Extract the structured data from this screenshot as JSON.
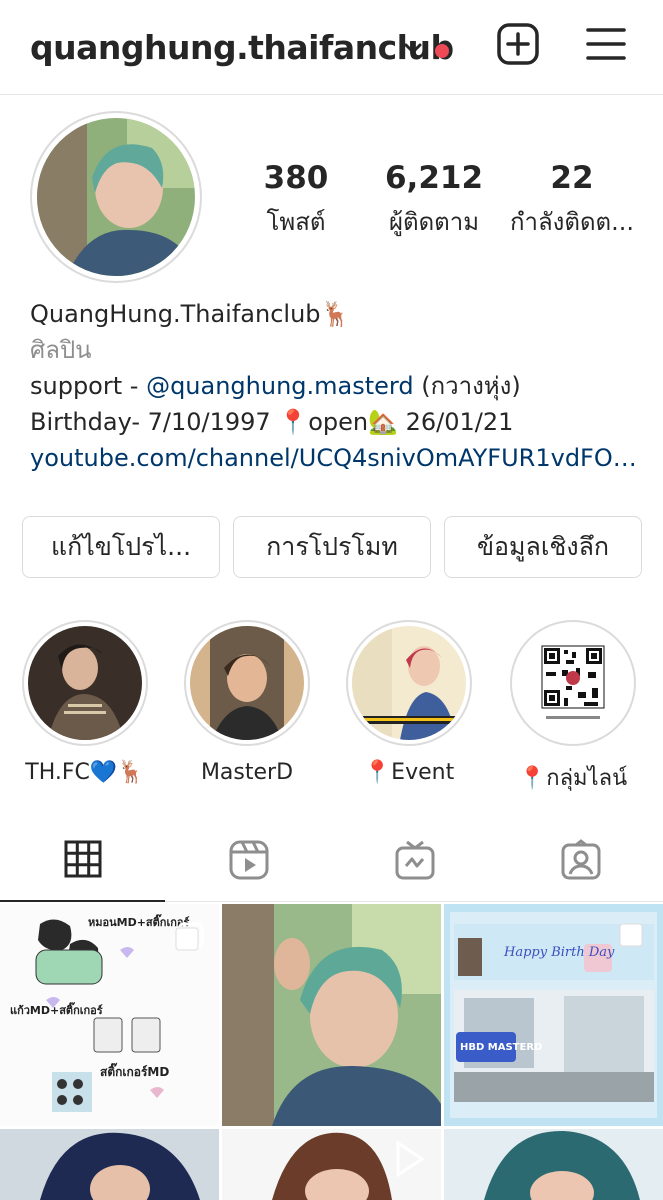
{
  "header": {
    "username": "quanghung.thaifanclub",
    "icons": [
      "chevron-down-icon",
      "notification-dot",
      "add-post-icon",
      "menu-icon"
    ],
    "notification_color": "#ed4956"
  },
  "profile": {
    "stats": [
      {
        "value": "380",
        "label": "โพสต์"
      },
      {
        "value": "6,212",
        "label": "ผู้ติดตาม"
      },
      {
        "value": "22",
        "label": "กำลังติดต..."
      }
    ],
    "display_name": "QuangHung.Thaifanclub🦌",
    "category": "ศิลปิน",
    "bio_line1_prefix": "support - ",
    "bio_line1_mention": "@quanghung.masterd",
    "bio_line1_suffix": " (กวางหุ่ง)",
    "bio_line2": "Birthday- 7/10/1997 📍open🏡 26/01/21",
    "link": "youtube.com/channel/UCQ4snivOmAYFUR1vdFOw..."
  },
  "actions": {
    "edit_profile": "แก้ไขโปรไ...",
    "promote": "การโปรโมท",
    "insights": "ข้อมูลเชิงลึก"
  },
  "highlights": [
    {
      "label": "TH.FC💙🦌"
    },
    {
      "label": "MasterD"
    },
    {
      "label": "📍Event"
    },
    {
      "label": "📍กลุ่มไลน์"
    }
  ],
  "tabs": [
    "grid-icon",
    "reels-icon",
    "igtv-icon",
    "tagged-icon"
  ],
  "colors": {
    "text": "#262626",
    "secondary": "#8e8e8e",
    "link": "#00376b",
    "border": "#dbdbdb"
  },
  "grid_posts": [
    {
      "name": "post-merch-promo",
      "text": [
        "หมอนMD+สติ๊กเกอร์",
        "แก้วMD+สติ๊กเกอร์",
        "สติ๊กเกอร์MD"
      ]
    },
    {
      "name": "post-portrait-tree"
    },
    {
      "name": "post-birthday-billboard",
      "text": [
        "Happy Birth Day",
        "HBD MASTERD"
      ]
    },
    {
      "name": "post-portrait-1"
    },
    {
      "name": "post-portrait-2"
    },
    {
      "name": "post-portrait-3"
    }
  ]
}
